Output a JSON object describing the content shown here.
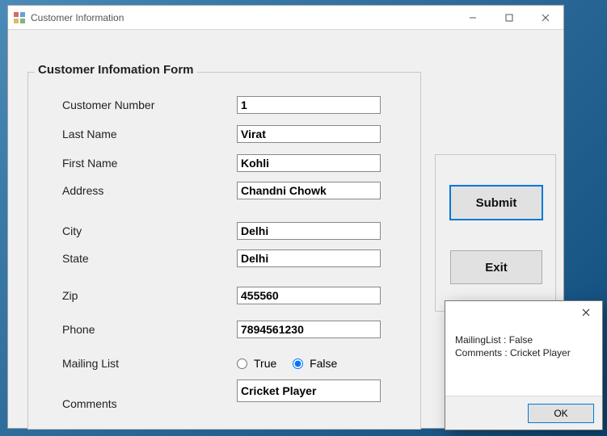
{
  "window": {
    "title": "Customer Information"
  },
  "group": {
    "title": "Customer Infomation Form"
  },
  "fields": {
    "customer_number": {
      "label": "Customer Number",
      "value": "1"
    },
    "last_name": {
      "label": "Last Name",
      "value": "Virat"
    },
    "first_name": {
      "label": "First Name",
      "value": "Kohli"
    },
    "address": {
      "label": "Address",
      "value": "Chandni Chowk"
    },
    "city": {
      "label": "City",
      "value": "Delhi"
    },
    "state": {
      "label": "State",
      "value": "Delhi"
    },
    "zip": {
      "label": "Zip",
      "value": "455560"
    },
    "phone": {
      "label": "Phone",
      "value": "7894561230"
    },
    "mailing_list": {
      "label": "Mailing List",
      "true_label": "True",
      "false_label": "False",
      "selected": "False"
    },
    "comments": {
      "label": "Comments",
      "value": "Cricket Player"
    }
  },
  "buttons": {
    "submit": "Submit",
    "exit": "Exit"
  },
  "messagebox": {
    "line1": "MailingList : False",
    "line2": "Comments : Cricket Player",
    "ok": "OK"
  }
}
